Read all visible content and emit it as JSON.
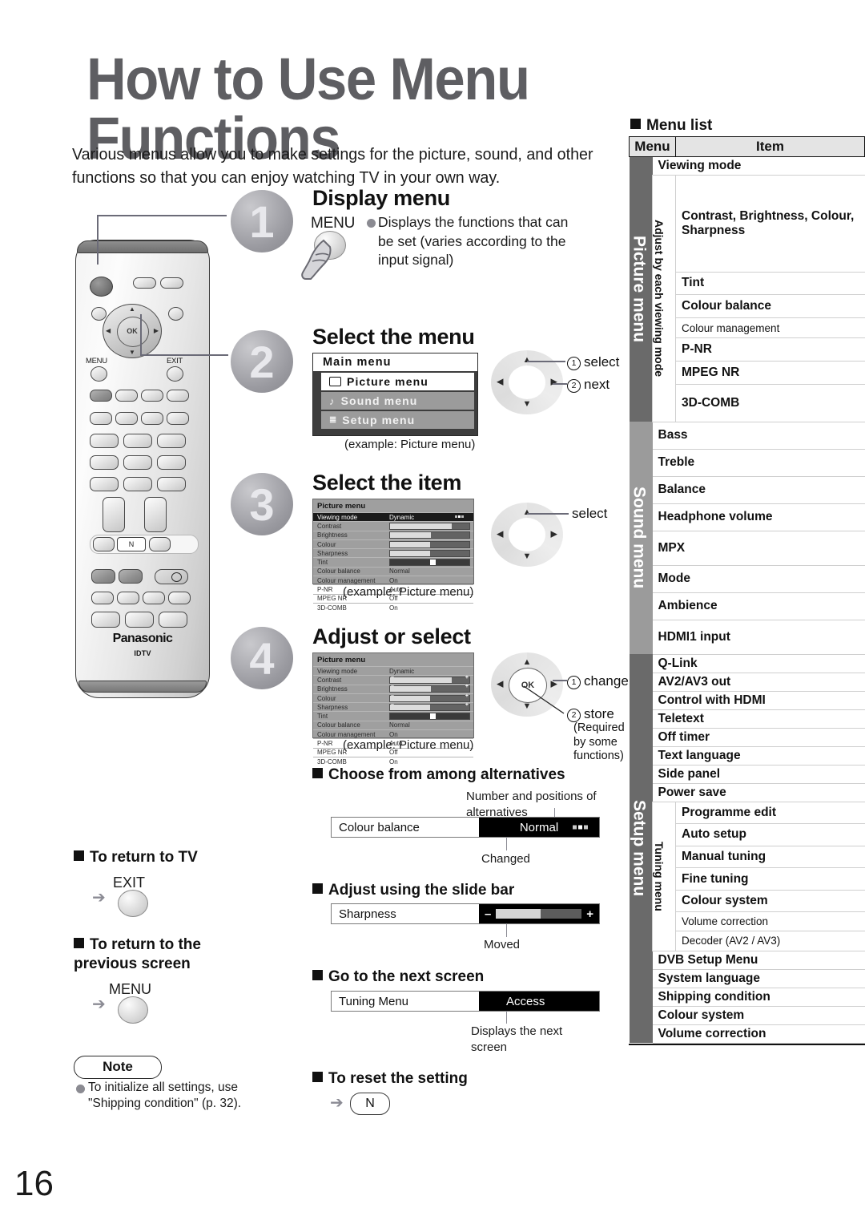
{
  "page": {
    "title": "How to Use Menu Functions",
    "number": "16",
    "intro": "Various menus allow you to make settings for the picture, sound, and other functions so that you can enjoy watching TV in your own way."
  },
  "remote": {
    "brand": "Panasonic",
    "model": "IDTV",
    "menu_label": "MENU",
    "exit_label": "EXIT",
    "ok_label": "OK",
    "n_key": "N"
  },
  "steps": [
    {
      "number": "1",
      "title": "Display menu",
      "button_label": "MENU",
      "description": "Displays the functions that can be set (varies according to the input signal)"
    },
    {
      "number": "2",
      "title": "Select the menu",
      "caption": "(example: Picture menu)",
      "osd": {
        "title": "Main menu",
        "rows": [
          {
            "label": "Picture menu",
            "icon": "rectangle-icon",
            "selected": true
          },
          {
            "label": "Sound menu",
            "icon": "music-note-icon",
            "selected": false
          },
          {
            "label": "Setup menu",
            "icon": "list-icon",
            "selected": false
          }
        ]
      },
      "annotations": [
        {
          "num": "1",
          "text": "select"
        },
        {
          "num": "2",
          "text": "next"
        }
      ]
    },
    {
      "number": "3",
      "title": "Select the item",
      "caption": "(example: Picture menu)",
      "annotations": [
        {
          "num": "",
          "text": "select"
        }
      ]
    },
    {
      "number": "4",
      "title": "Adjust or select",
      "caption": "(example: Picture menu)",
      "annotations": [
        {
          "num": "1",
          "text": "change"
        },
        {
          "num": "2",
          "text": "store"
        }
      ],
      "store_note": "(Required by some functions)"
    }
  ],
  "picture_menu_osd": {
    "title": "Picture menu",
    "rows": [
      {
        "name": "Viewing mode",
        "value": "Dynamic",
        "type": "choice"
      },
      {
        "name": "Contrast",
        "value": "",
        "type": "bar",
        "fill": 78
      },
      {
        "name": "Brightness",
        "value": "",
        "type": "bar",
        "fill": 52
      },
      {
        "name": "Colour",
        "value": "",
        "type": "bar",
        "fill": 50
      },
      {
        "name": "Sharpness",
        "value": "",
        "type": "bar",
        "fill": 50
      },
      {
        "name": "Tint",
        "value": "",
        "type": "center",
        "fill": 50
      },
      {
        "name": "Colour balance",
        "value": "Normal",
        "type": "text"
      },
      {
        "name": "Colour management",
        "value": "On",
        "type": "text"
      },
      {
        "name": "P-NR",
        "value": "Auto",
        "type": "text"
      },
      {
        "name": "MPEG NR",
        "value": "Off",
        "type": "text"
      },
      {
        "name": "3D-COMB",
        "value": "On",
        "type": "text"
      }
    ]
  },
  "alternatives": {
    "heading": "Choose from among alternatives",
    "callout_top": "Number and positions of alternatives",
    "callout_bottom": "Changed",
    "row_label": "Colour balance",
    "row_value": "Normal"
  },
  "slide_bar": {
    "heading": "Adjust using the slide bar",
    "row_label": "Sharpness",
    "minus": "–",
    "plus": "+",
    "callout": "Moved"
  },
  "next_screen": {
    "heading": "Go to the next screen",
    "row_label": "Tuning Menu",
    "row_value": "Access",
    "callout": "Displays the next screen"
  },
  "reset": {
    "heading": "To reset the setting",
    "button": "N"
  },
  "return_tv": {
    "heading": "To return to TV",
    "button": "EXIT"
  },
  "return_prev": {
    "heading": "To return to the previous screen",
    "button": "MENU"
  },
  "note": {
    "caption": "Note",
    "text": "To initialize all settings, use \"Shipping condition\" (p. 32)."
  },
  "menu_list": {
    "heading": "Menu list",
    "col_menu": "Menu",
    "col_item": "Item",
    "groups": [
      {
        "name": "Picture menu",
        "subgroup": "Adjust by each viewing mode",
        "pre_items": [
          "Viewing mode"
        ],
        "sub_items": [
          {
            "label": "Contrast, Brightness, Colour, Sharpness",
            "small": false,
            "tall": true
          },
          {
            "label": "Tint",
            "small": false
          },
          {
            "label": "Colour balance",
            "small": false
          },
          {
            "label": "Colour management",
            "small": true
          },
          {
            "label": "P-NR",
            "small": false
          },
          {
            "label": "MPEG NR",
            "small": false
          },
          {
            "label": "3D-COMB",
            "small": false,
            "tall": true
          }
        ]
      },
      {
        "name": "Sound menu",
        "items": [
          "Bass",
          "Treble",
          "Balance",
          "Headphone volume",
          "MPX",
          "Mode",
          "Ambience",
          "HDMI1 input"
        ]
      },
      {
        "name": "Setup menu",
        "pre_items": [
          "Q-Link",
          "AV2/AV3 out",
          "Control with HDMI",
          "Teletext",
          "Off timer",
          "Text language",
          "Side panel",
          "Power save"
        ],
        "subgroup": "Tuning menu",
        "sub_items": [
          {
            "label": "Programme edit",
            "small": false
          },
          {
            "label": "Auto setup",
            "small": false
          },
          {
            "label": "Manual tuning",
            "small": false
          },
          {
            "label": "Fine tuning",
            "small": false
          },
          {
            "label": "Colour system",
            "small": false
          },
          {
            "label": "Volume correction",
            "small": true
          },
          {
            "label": "Decoder (AV2 / AV3)",
            "small": true
          }
        ],
        "post_items": [
          "DVB Setup Menu",
          "System language",
          "Shipping condition",
          "Colour system",
          "Volume correction"
        ]
      }
    ]
  },
  "colors": {
    "title_gray": "#5e5e62",
    "group_dark": "#6a6a6a",
    "group_mid": "#9b9b9b",
    "header_bg": "#e4e4e4"
  }
}
